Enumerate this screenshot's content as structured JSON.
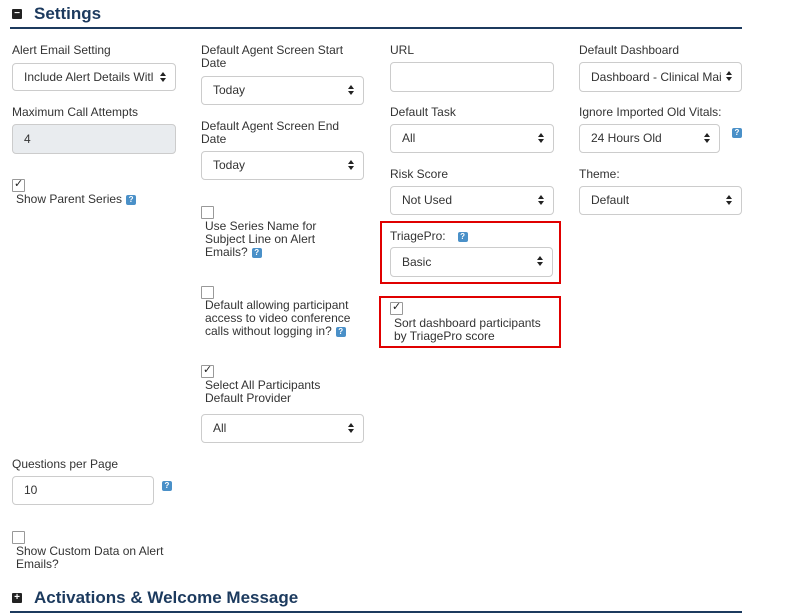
{
  "settings_section": {
    "title": "Settings",
    "toggle": "−"
  },
  "activations_section": {
    "title": "Activations & Welcome Message",
    "toggle": "+"
  },
  "help_glyph": "?",
  "col1": {
    "alert_email_label": "Alert Email Setting",
    "alert_email_value": "Include Alert Details Witl",
    "max_call_label": "Maximum Call Attempts",
    "max_call_value": "4",
    "show_parent_series_label": "Show Parent Series",
    "questions_per_page_label": "Questions per Page",
    "questions_per_page_value": "10",
    "show_custom_data_label": "Show Custom Data on Alert Emails?"
  },
  "col2": {
    "start_date_label": "Default Agent Screen Start Date",
    "start_date_value": "Today",
    "end_date_label": "Default Agent Screen End Date",
    "end_date_value": "Today",
    "series_name_label": "Use Series Name for Subject Line on Alert Emails?",
    "video_access_label": "Default allowing participant access to video conference calls without logging in?",
    "select_all_label": "Select All Participants Default Provider",
    "default_provider_value": "All"
  },
  "col3": {
    "url_label": "URL",
    "url_value": "",
    "default_task_label": "Default Task",
    "default_task_value": "All",
    "risk_score_label": "Risk Score",
    "risk_score_value": "Not Used",
    "triagepro_label": "TriagePro:",
    "triagepro_value": "Basic",
    "sort_dashboard_label": "Sort dashboard participants by TriagePro score"
  },
  "col4": {
    "default_dashboard_label": "Default Dashboard",
    "default_dashboard_value": "Dashboard - Clinical Mai",
    "ignore_vitals_label": "Ignore Imported Old Vitals:",
    "ignore_vitals_value": "24 Hours Old",
    "theme_label": "Theme:",
    "theme_value": "Default"
  },
  "colors": {
    "heading": "#1c3a5e",
    "highlight": "#e00000",
    "help": "#4a90c8"
  }
}
